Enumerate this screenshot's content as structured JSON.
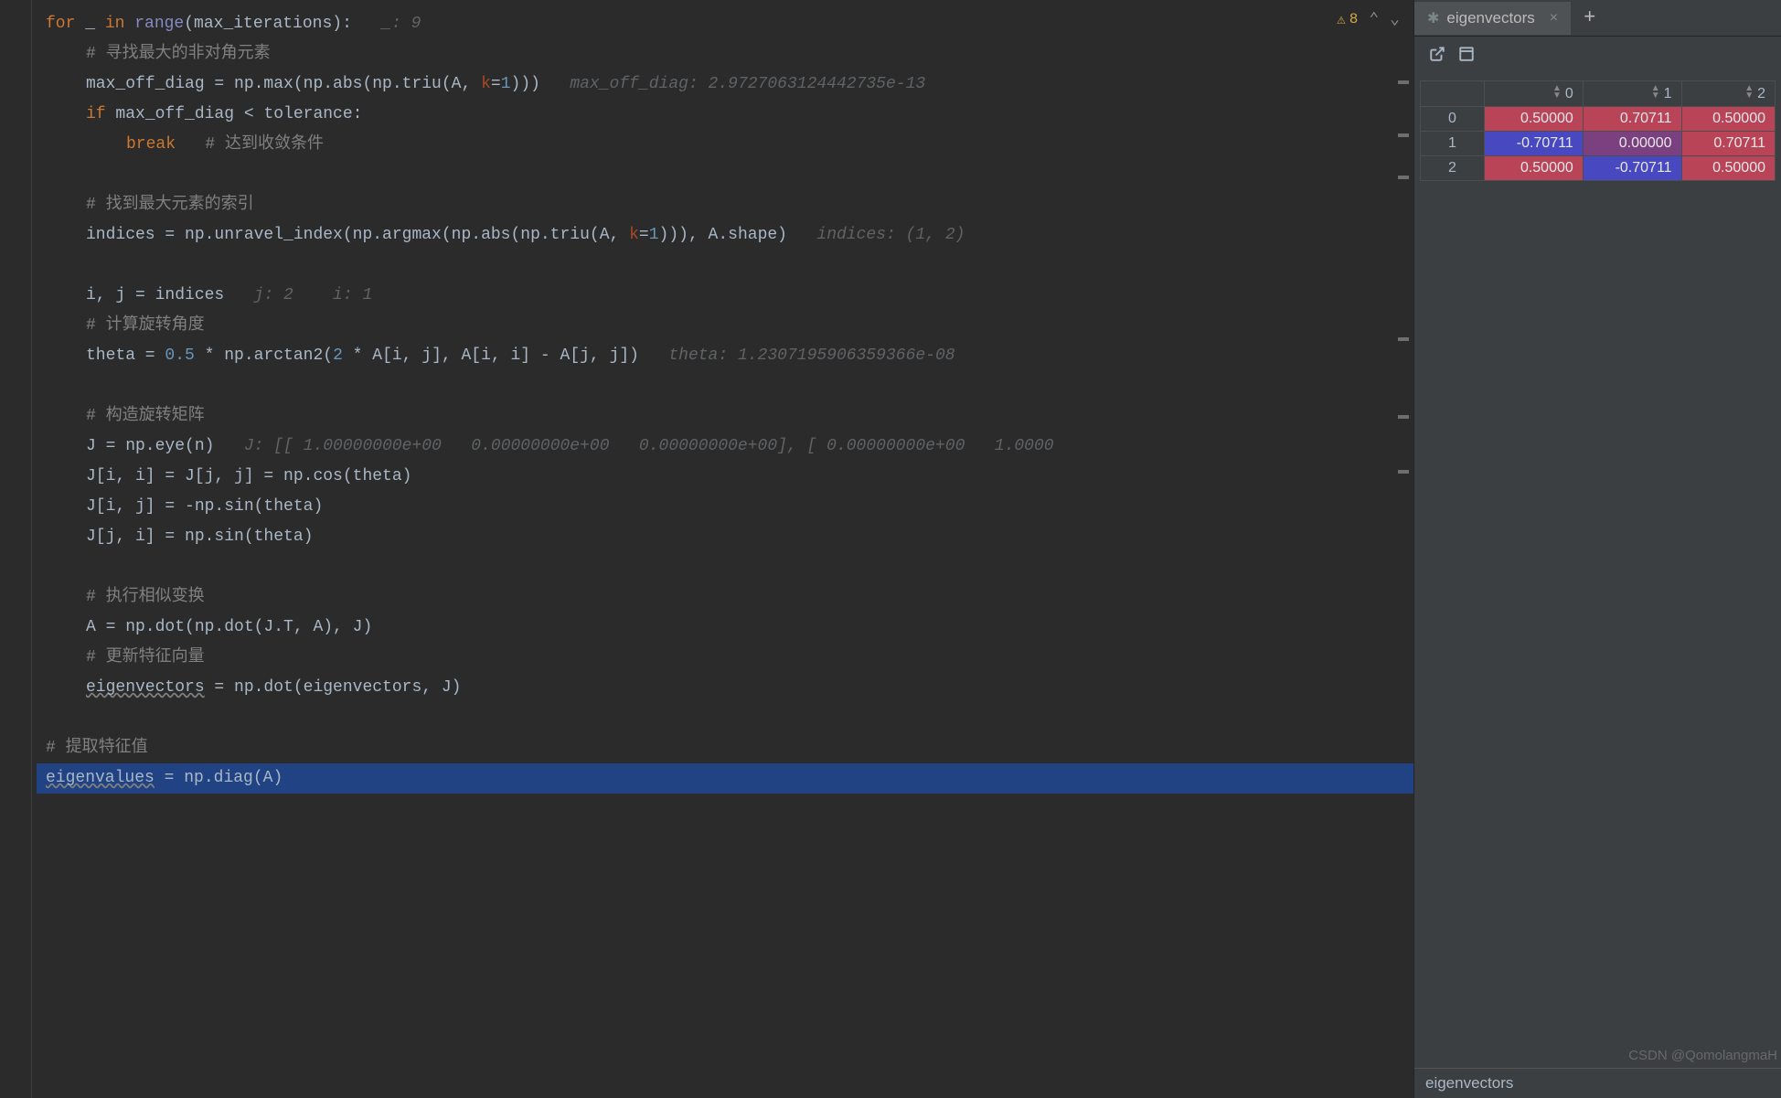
{
  "toolbar": {
    "warning_count": "8"
  },
  "code": {
    "line1_for": "for",
    "line1_underscore": " _ ",
    "line1_in": "in",
    "line1_range": " range",
    "line1_rest": "(max_iterations):",
    "line1_hint": "   _: 9",
    "line2_comment": "# 寻找最大的非对角元素",
    "line3_a": "max_off_diag = np.max(np.abs(np.triu(A, ",
    "line3_k": "k",
    "line3_b": "=",
    "line3_n": "1",
    "line3_c": ")))",
    "line3_hint": "   max_off_diag: 2.9727063124442735e-13",
    "line4_if": "if",
    "line4_rest": " max_off_diag < tolerance:",
    "line5_break": "break",
    "line5_hint": "   # 达到收敛条件",
    "line7_comment": "# 找到最大元素的索引",
    "line8_a": "indices = np.unravel_index(np.argmax(np.abs(np.triu(A, ",
    "line8_k": "k",
    "line8_b": "=",
    "line8_n": "1",
    "line8_c": "))), A.shape)",
    "line8_hint": "   indices: (1, 2)",
    "line10": "i, j = indices",
    "line10_hint": "   j: 2    i: 1",
    "line11_comment": "# 计算旋转角度",
    "line12_a": "theta = ",
    "line12_n1": "0.5",
    "line12_b": " * np.arctan2(",
    "line12_n2": "2",
    "line12_c": " * A[i, j], A[i, i] - A[j, j])",
    "line12_hint": "   theta: 1.2307195906359366e-08",
    "line14_comment": "# 构造旋转矩阵",
    "line15": "J = np.eye(n)",
    "line15_hint": "   J: [[ 1.00000000e+00   0.00000000e+00   0.00000000e+00], [ 0.00000000e+00   1.0000",
    "line16": "J[i, i] = J[j, j] = np.cos(theta)",
    "line17": "J[i, j] = -np.sin(theta)",
    "line18": "J[j, i] = np.sin(theta)",
    "line20_comment": "# 执行相似变换",
    "line21": "A = np.dot(np.dot(J.T, A), J)",
    "line22_comment": "# 更新特征向量",
    "line23_a": "eigenvectors",
    "line23_b": " = np.dot(eigenvectors, J)",
    "line25_comment": "# 提取特征值",
    "line26_a": "eigenvalues",
    "line26_b": " = np.diag(A)"
  },
  "side": {
    "tab_name": "eigenvectors",
    "footer_text": "eigenvectors",
    "columns": [
      "0",
      "1",
      "2"
    ],
    "rows": [
      {
        "idx": "0",
        "cells": [
          {
            "v": "0.50000",
            "c": "cell-red"
          },
          {
            "v": "0.70711",
            "c": "cell-red"
          },
          {
            "v": "0.50000",
            "c": "cell-red"
          }
        ]
      },
      {
        "idx": "1",
        "cells": [
          {
            "v": "-0.70711",
            "c": "cell-blue"
          },
          {
            "v": "0.00000",
            "c": "cell-purple"
          },
          {
            "v": "0.70711",
            "c": "cell-red"
          }
        ]
      },
      {
        "idx": "2",
        "cells": [
          {
            "v": "0.50000",
            "c": "cell-red"
          },
          {
            "v": "-0.70711",
            "c": "cell-blue"
          },
          {
            "v": "0.50000",
            "c": "cell-red"
          }
        ]
      }
    ]
  },
  "watermark": "CSDN @QomolangmaH"
}
